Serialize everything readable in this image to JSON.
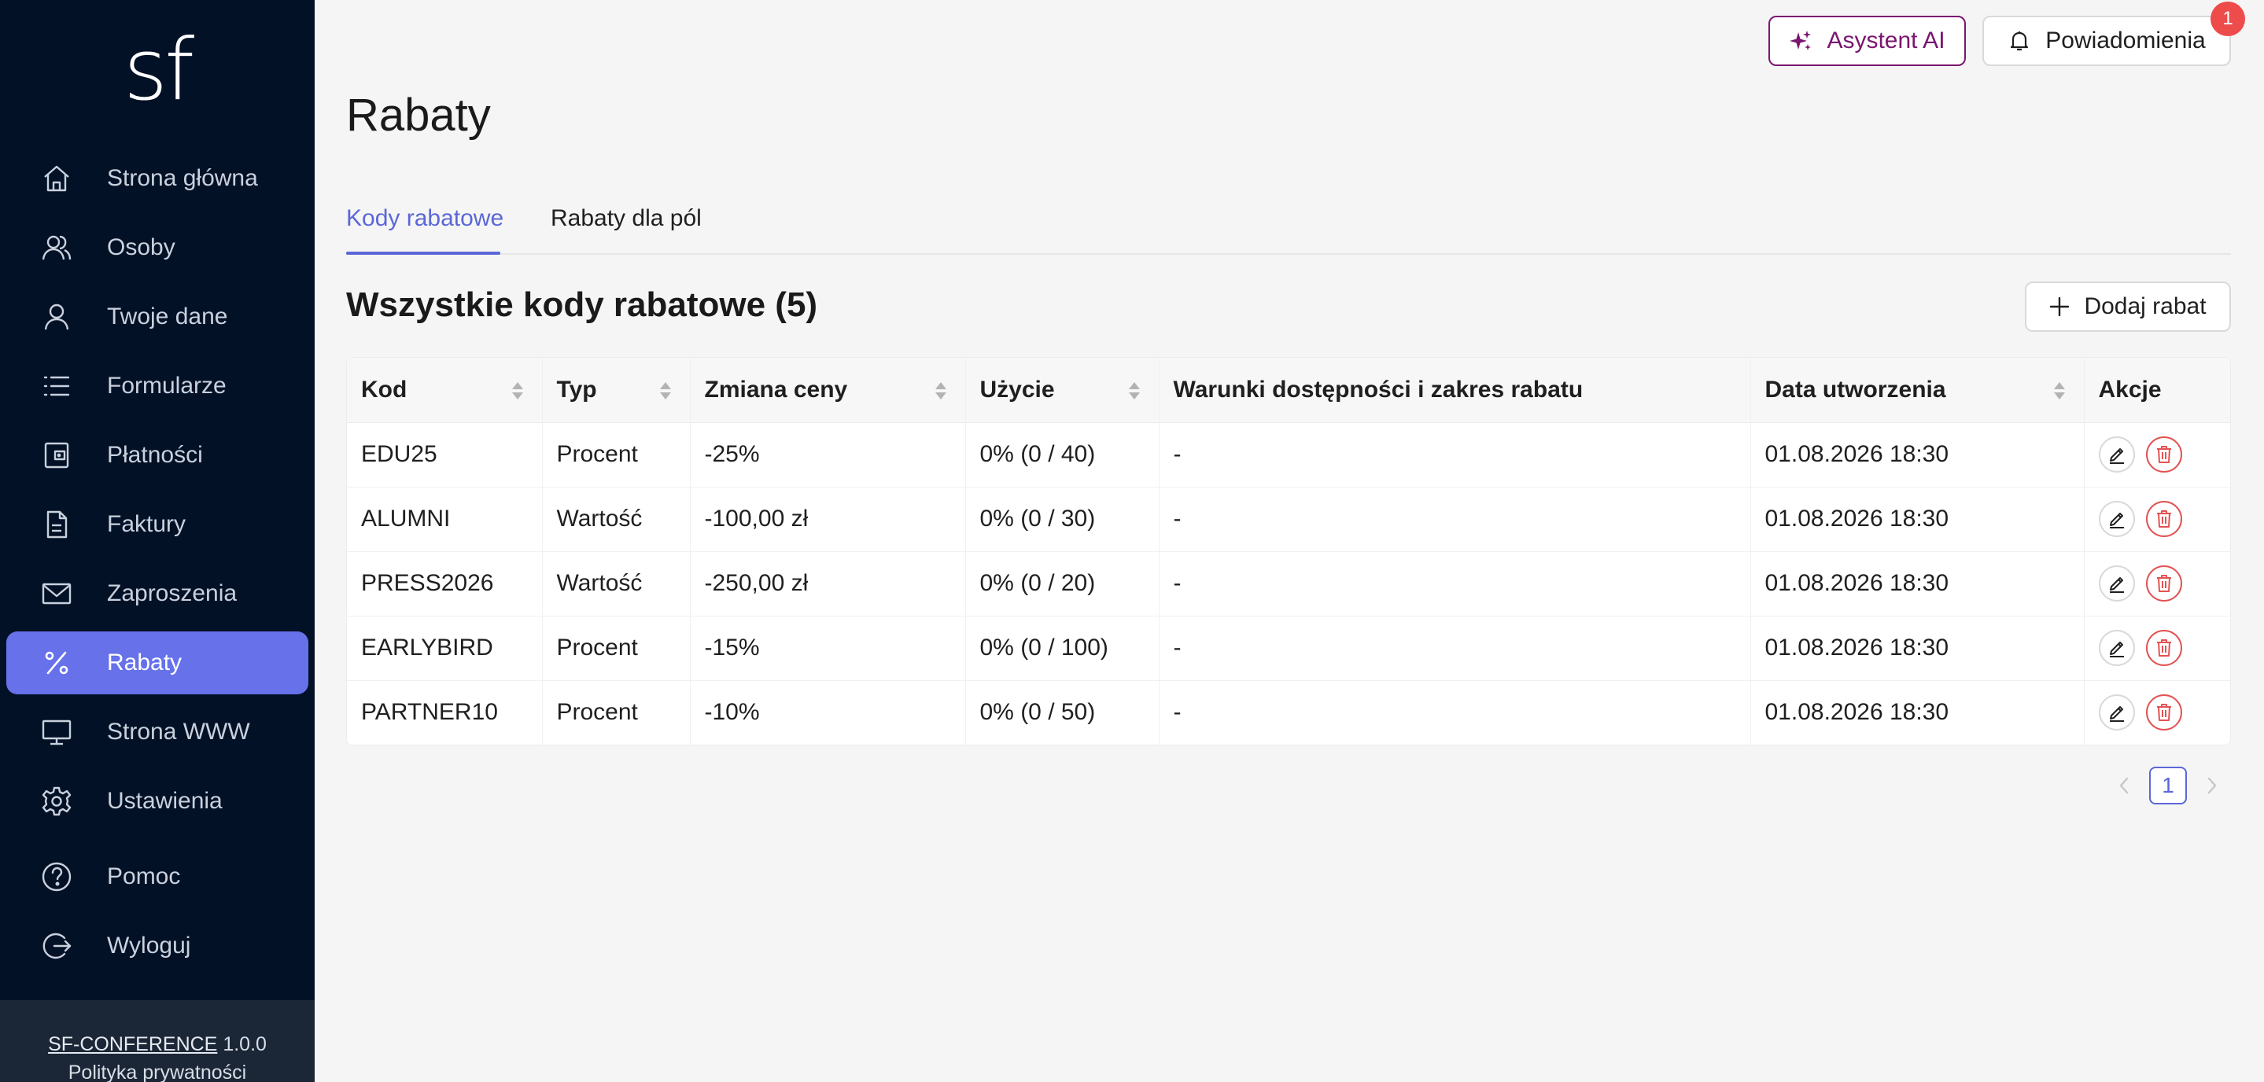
{
  "sidebar": {
    "logo": "sf",
    "items": [
      {
        "label": "Strona główna",
        "icon": "home-icon"
      },
      {
        "label": "Osoby",
        "icon": "people-icon"
      },
      {
        "label": "Twoje dane",
        "icon": "user-icon"
      },
      {
        "label": "Formularze",
        "icon": "list-icon"
      },
      {
        "label": "Płatności",
        "icon": "wallet-icon"
      },
      {
        "label": "Faktury",
        "icon": "document-icon"
      },
      {
        "label": "Zaproszenia",
        "icon": "mail-icon"
      },
      {
        "label": "Rabaty",
        "icon": "percent-icon",
        "active": true
      },
      {
        "label": "Strona WWW",
        "icon": "monitor-icon"
      },
      {
        "label": "Ustawienia",
        "icon": "gear-icon"
      },
      {
        "label": "Pomoc",
        "icon": "help-icon"
      },
      {
        "label": "Wyloguj",
        "icon": "logout-icon"
      }
    ],
    "footer": {
      "app_name": "SF-CONFERENCE",
      "version": "1.0.0",
      "privacy": "Polityka prywatności"
    }
  },
  "topbar": {
    "ai_label": "Asystent AI",
    "notifications_label": "Powiadomienia",
    "notifications_count": "1"
  },
  "page": {
    "title": "Rabaty",
    "tabs": [
      {
        "label": "Kody rabatowe",
        "active": true
      },
      {
        "label": "Rabaty dla pól",
        "active": false
      }
    ],
    "section_title": "Wszystkie kody rabatowe (5)",
    "add_label": "Dodaj rabat"
  },
  "table": {
    "columns": [
      "Kod",
      "Typ",
      "Zmiana ceny",
      "Użycie",
      "Warunki dostępności i zakres rabatu",
      "Data utworzenia",
      "Akcje"
    ],
    "rows": [
      {
        "code": "EDU25",
        "type": "Procent",
        "change": "-25%",
        "usage": "0% (0 / 40)",
        "conditions": "-",
        "created": "01.08.2026 18:30"
      },
      {
        "code": "ALUMNI",
        "type": "Wartość",
        "change": "-100,00 zł",
        "usage": "0% (0 / 30)",
        "conditions": "-",
        "created": "01.08.2026 18:30"
      },
      {
        "code": "PRESS2026",
        "type": "Wartość",
        "change": "-250,00 zł",
        "usage": "0% (0 / 20)",
        "conditions": "-",
        "created": "01.08.2026 18:30"
      },
      {
        "code": "EARLYBIRD",
        "type": "Procent",
        "change": "-15%",
        "usage": "0% (0 / 100)",
        "conditions": "-",
        "created": "01.08.2026 18:30"
      },
      {
        "code": "PARTNER10",
        "type": "Procent",
        "change": "-10%",
        "usage": "0% (0 / 50)",
        "conditions": "-",
        "created": "01.08.2026 18:30"
      }
    ]
  },
  "pagination": {
    "current": "1"
  },
  "colors": {
    "sidebar_bg": "#031127",
    "active_nav": "#6671ea",
    "accent": "#5b67d8",
    "ai_purple": "#7a1670",
    "danger": "#e35252"
  }
}
